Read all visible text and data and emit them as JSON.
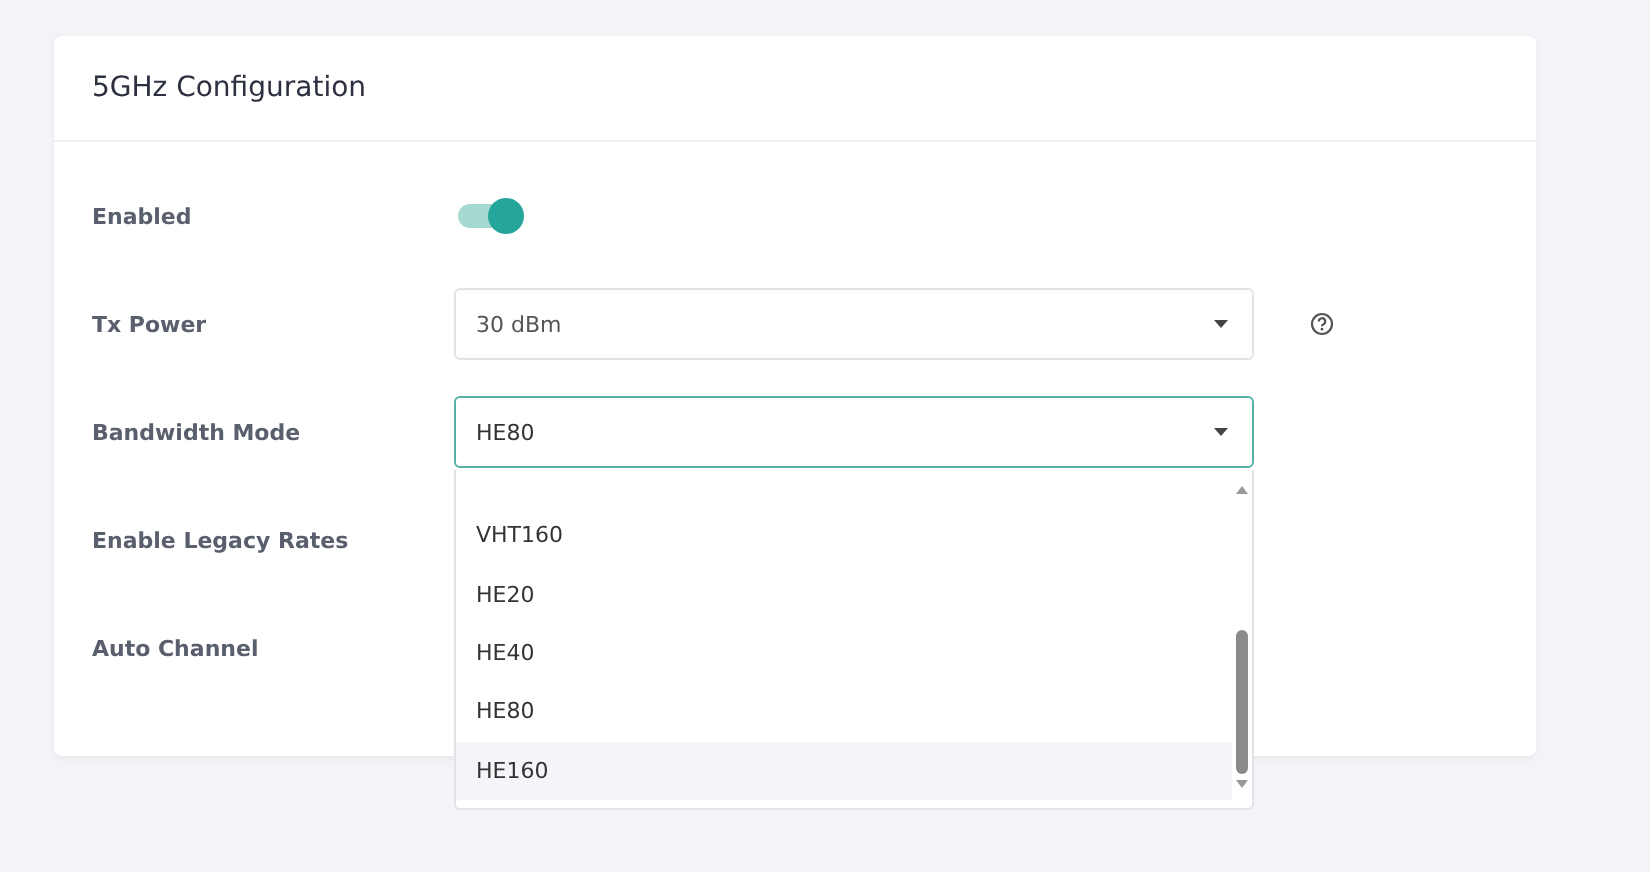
{
  "card": {
    "title": "5GHz Configuration"
  },
  "rows": [
    {
      "kind": "toggle",
      "label": "Enabled",
      "on": true
    },
    {
      "kind": "select",
      "label": "Tx Power",
      "value": "30 dBm",
      "open": false,
      "help": true
    },
    {
      "kind": "select",
      "label": "Bandwidth Mode",
      "value": "HE80",
      "open": true,
      "help": false,
      "options": [
        {
          "label": "VHT160",
          "highlighted": false
        },
        {
          "label": "HE20",
          "highlighted": false
        },
        {
          "label": "HE40",
          "highlighted": false
        },
        {
          "label": "HE80",
          "highlighted": false
        },
        {
          "label": "HE160",
          "highlighted": true
        }
      ]
    },
    {
      "kind": "plain",
      "label": "Enable Legacy Rates"
    },
    {
      "kind": "plain",
      "label": "Auto Channel"
    }
  ]
}
